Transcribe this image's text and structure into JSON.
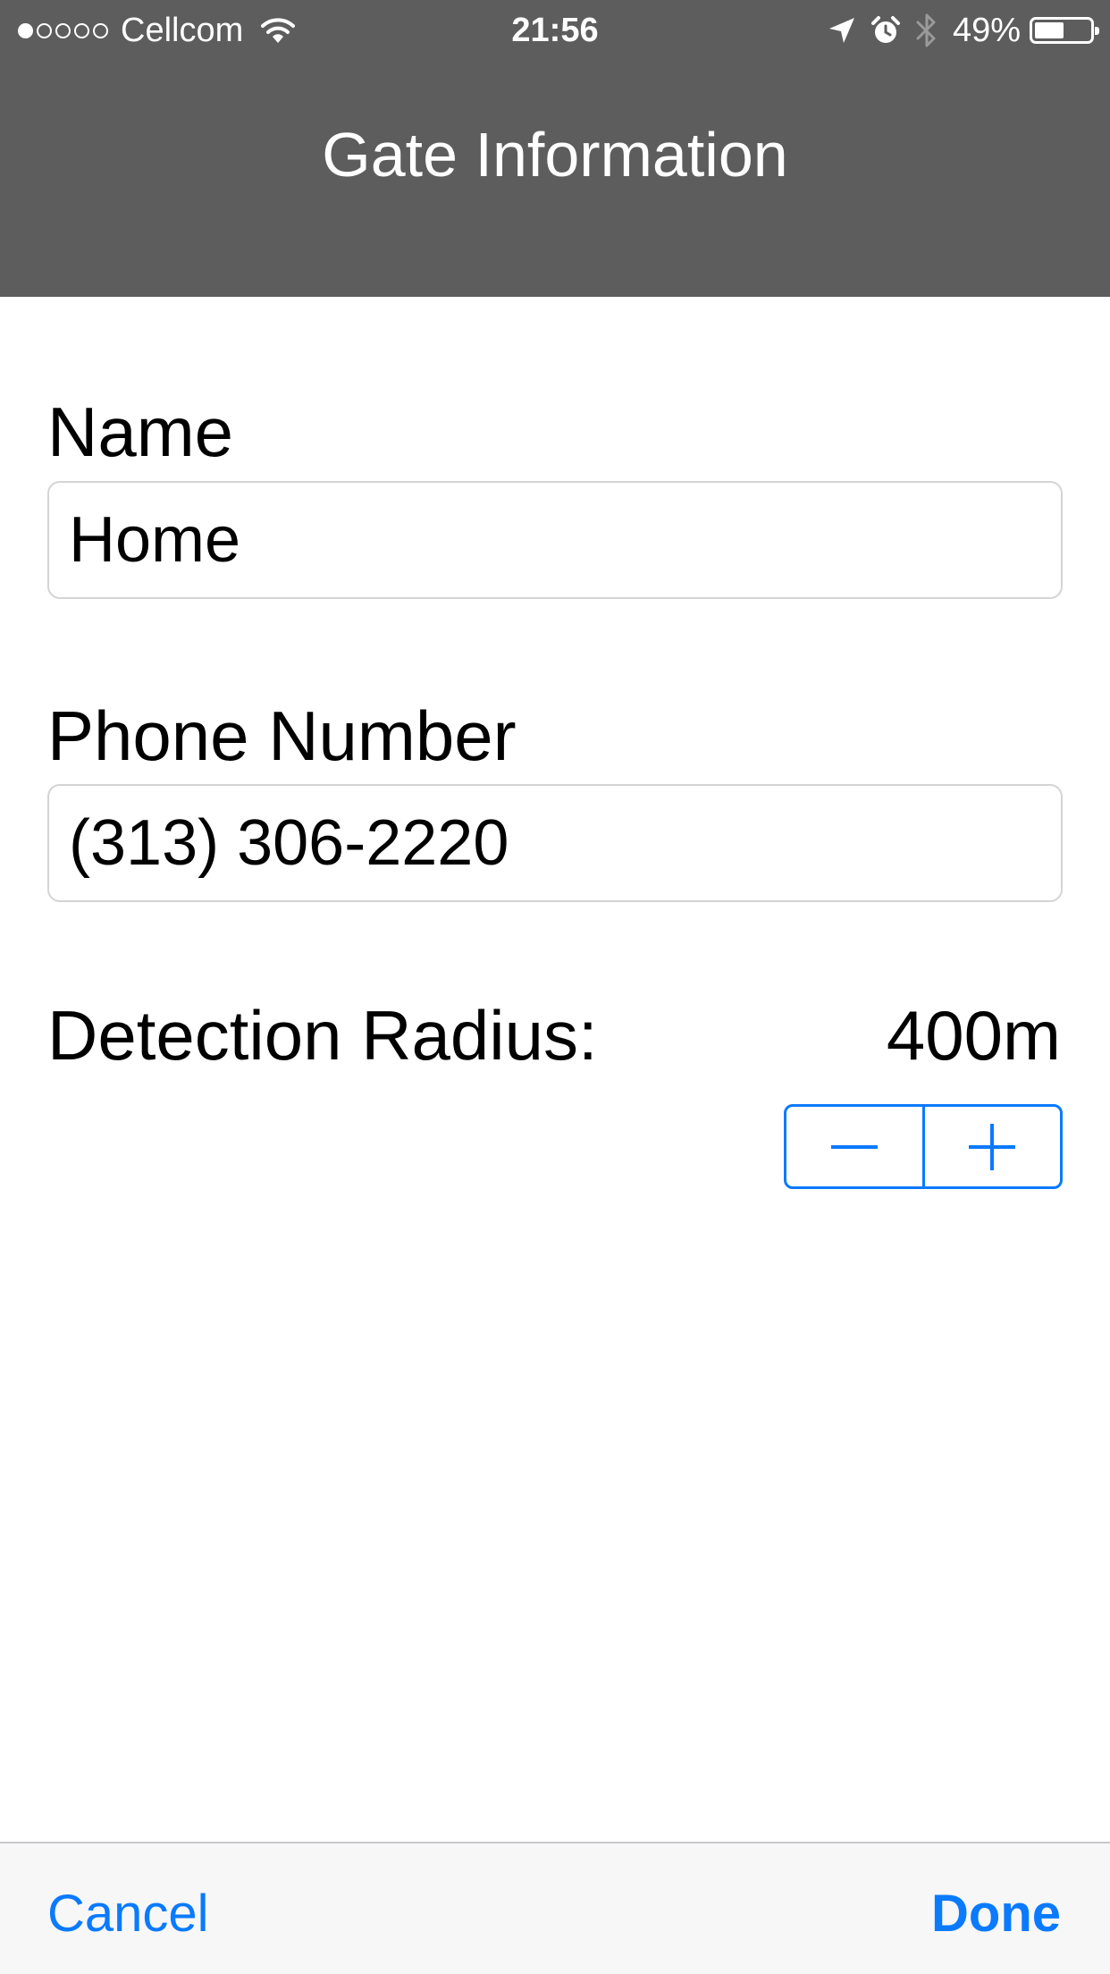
{
  "status_bar": {
    "signal_bars_filled": 1,
    "signal_bars_total": 5,
    "carrier": "Cellcom",
    "time": "21:56",
    "battery_percent_label": "49%",
    "battery_level": 0.49,
    "icons": [
      "wifi-icon",
      "location-arrow-icon",
      "alarm-icon",
      "bluetooth-icon",
      "battery-icon"
    ]
  },
  "nav": {
    "title": "Gate Information"
  },
  "form": {
    "name_label": "Name",
    "name_value": "Home",
    "phone_label": "Phone Number",
    "phone_value": "(313) 306-2220",
    "radius_label": "Detection Radius:",
    "radius_value": "400m",
    "stepper_icons": [
      "minus-icon",
      "plus-icon"
    ]
  },
  "toolbar": {
    "cancel_label": "Cancel",
    "done_label": "Done"
  },
  "colors": {
    "header_bg": "#5d5d5d",
    "accent": "#0a7aff",
    "toolbar_bg": "#f7f7f7",
    "field_border": "#d4d4d4"
  }
}
